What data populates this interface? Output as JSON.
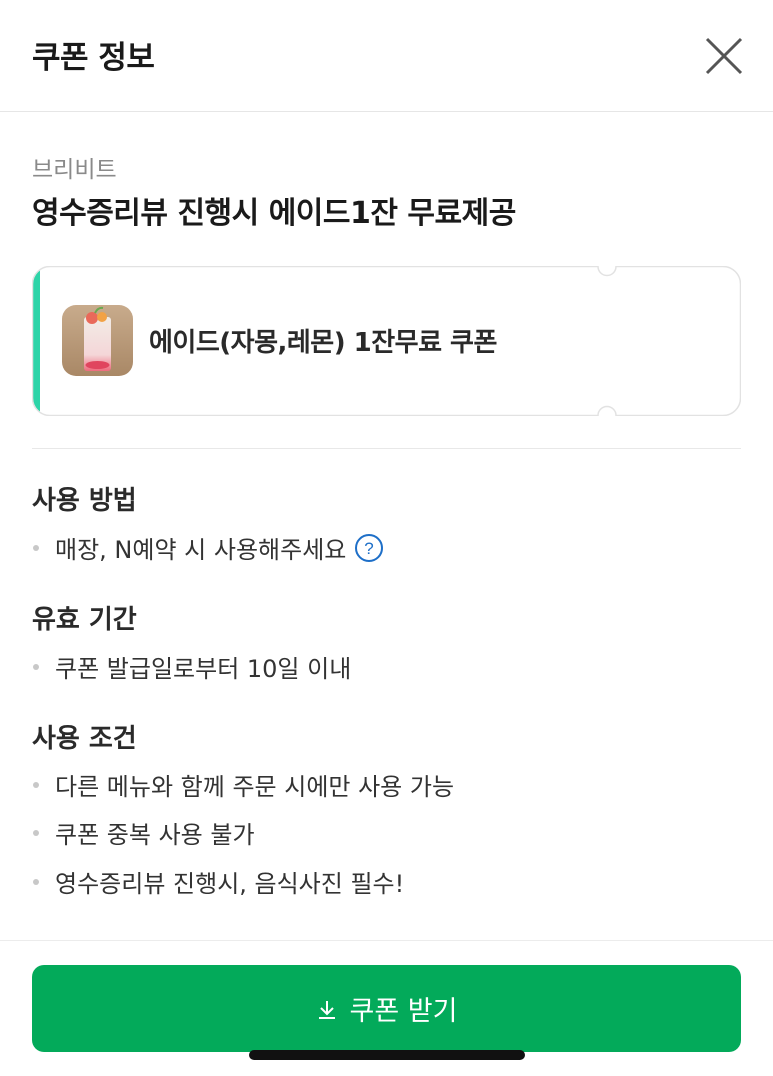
{
  "header": {
    "title": "쿠폰 정보"
  },
  "store": {
    "name": "브리비트"
  },
  "coupon": {
    "title": "영수증리뷰 진행시 에이드1잔 무료제공",
    "item_label": "에이드(자몽,레몬) 1잔무료 쿠폰",
    "accent_color": "#2dd4a8"
  },
  "sections": {
    "usage": {
      "title": "사용 방법",
      "items": [
        "매장, N예약 시 사용해주세요"
      ]
    },
    "validity": {
      "title": "유효 기간",
      "items": [
        "쿠폰 발급일로부터 10일 이내"
      ]
    },
    "conditions": {
      "title": "사용 조건",
      "items": [
        "다른 메뉴와 함께 주문 시에만 사용 가능",
        "쿠폰 중복 사용 불가",
        "영수증리뷰 진행시, 음식사진 필수!"
      ]
    }
  },
  "cta": {
    "label": "쿠폰 받기",
    "color": "#03aa5a"
  },
  "icons": {
    "close": "close-icon",
    "help": "help-icon",
    "download": "download-icon"
  }
}
